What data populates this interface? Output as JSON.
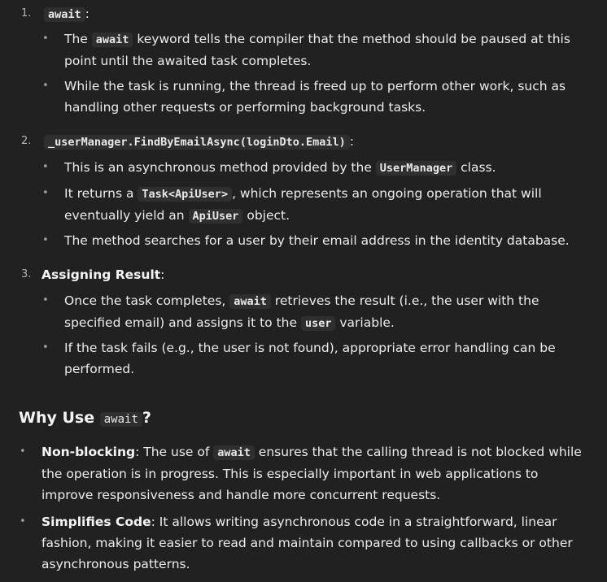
{
  "list": {
    "item1": {
      "number": "1.",
      "code": "await",
      "suffix": ":",
      "bullets": [
        {
          "t1": "The ",
          "code": "await",
          "t2": " keyword tells the compiler that the method should be paused at this point until the awaited task completes."
        },
        {
          "t1": "While the task is running, the thread is freed up to perform other work, such as handling other requests or performing background tasks."
        }
      ]
    },
    "item2": {
      "number": "2.",
      "code": "_userManager.FindByEmailAsync(loginDto.Email)",
      "suffix": ":",
      "b1": {
        "t1": "This is an asynchronous method provided by the ",
        "code": "UserManager",
        "t2": " class."
      },
      "b2": {
        "t1": "It returns a ",
        "code1": "Task<ApiUser>",
        "t2": ", which represents an ongoing operation that will eventually yield an ",
        "code2": "ApiUser",
        "t3": " object."
      },
      "b3": {
        "t1": "The method searches for a user by their email address in the identity database."
      }
    },
    "item3": {
      "number": "3.",
      "title": "Assigning Result",
      "suffix": ":",
      "b1": {
        "t1": "Once the task completes, ",
        "code1": "await",
        "t2": " retrieves the result (i.e., the user with the specified email) and assigns it to the ",
        "code2": "user",
        "t3": " variable."
      },
      "b2": {
        "t1": "If the task fails (e.g., the user is not found), appropriate error handling can be performed."
      }
    }
  },
  "section": {
    "title_pre": "Why Use ",
    "title_code": "await",
    "title_post": "?",
    "b1": {
      "bold": "Non-blocking",
      "t1": ": The use of ",
      "code": "await",
      "t2": " ensures that the calling thread is not blocked while the operation is in progress. This is especially important in web applications to improve responsiveness and handle more concurrent requests."
    },
    "b2": {
      "bold": "Simplifies Code",
      "t1": ": It allows writing asynchronous code in a straightforward, linear fashion, making it easier to read and maintain compared to using callbacks or other asynchronous patterns."
    }
  },
  "bullet_char": "•"
}
